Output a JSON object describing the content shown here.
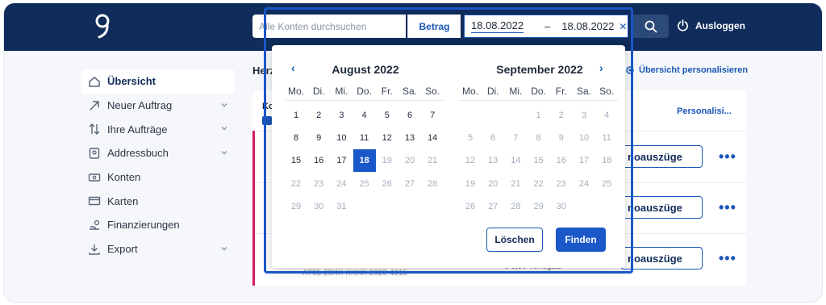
{
  "colors": {
    "navy": "#0f2c5a",
    "accent": "#1a57c8",
    "stripe": "#d81b60"
  },
  "header": {
    "logout_label": "Ausloggen"
  },
  "search": {
    "placeholder": "Alle Konten durchsuchen",
    "amount_label": "Betrag",
    "date_from": "18.08.2022",
    "date_separator": "–",
    "date_to": "18.08.2022",
    "clear_icon": "close-icon"
  },
  "sidebar": {
    "items": [
      {
        "label": "Übersicht",
        "icon": "home-icon",
        "expandable": false,
        "active": true
      },
      {
        "label": "Neuer Auftrag",
        "icon": "arrow-up-right-icon",
        "expandable": true
      },
      {
        "label": "Ihre Aufträge",
        "icon": "transfer-icon",
        "expandable": true
      },
      {
        "label": "Addressbuch",
        "icon": "address-book-icon",
        "expandable": true
      },
      {
        "label": "Konten",
        "icon": "bank-note-icon",
        "expandable": false
      },
      {
        "label": "Karten",
        "icon": "card-icon",
        "expandable": false
      },
      {
        "label": "Finanzierungen",
        "icon": "financing-icon",
        "expandable": false
      },
      {
        "label": "Export",
        "icon": "download-icon",
        "expandable": true
      }
    ]
  },
  "main": {
    "heading_partial": "Herz",
    "personalize_top": "Übersicht personalisieren",
    "section_title_partial": "Ko",
    "personalize_right": "Personalisi...",
    "row_button_label": "noauszüge",
    "more_label": "•••",
    "iban_partial": "AT05 20XX XXXX 2020 4015",
    "available_partial": "€ 0,00 verfügbar"
  },
  "datepicker": {
    "months": [
      {
        "title": "August 2022",
        "weekdays": [
          "Mo.",
          "Di.",
          "Mi.",
          "Do.",
          "Fr.",
          "Sa.",
          "So."
        ],
        "weeks": [
          [
            "1",
            "2",
            "3",
            "4",
            "5",
            "6",
            "7"
          ],
          [
            "8",
            "9",
            "10",
            "11",
            "12",
            "13",
            "14"
          ],
          [
            "15",
            "16",
            "17",
            "18",
            "19",
            "20",
            "21"
          ],
          [
            "22",
            "23",
            "24",
            "25",
            "26",
            "27",
            "28"
          ],
          [
            "29",
            "30",
            "31",
            "",
            "",
            "",
            ""
          ]
        ],
        "enabled_through": 18,
        "selected": 18
      },
      {
        "title": "September 2022",
        "weekdays": [
          "Mo.",
          "Di.",
          "Mi.",
          "Do.",
          "Fr.",
          "Sa.",
          "So."
        ],
        "weeks": [
          [
            "",
            "",
            "",
            "1",
            "2",
            "3",
            "4"
          ],
          [
            "5",
            "6",
            "7",
            "8",
            "9",
            "10",
            "11"
          ],
          [
            "12",
            "13",
            "14",
            "15",
            "16",
            "17",
            "18"
          ],
          [
            "19",
            "20",
            "21",
            "22",
            "23",
            "24",
            "25"
          ],
          [
            "26",
            "27",
            "28",
            "29",
            "30",
            "",
            ""
          ]
        ],
        "enabled_through": 0,
        "selected": null
      }
    ],
    "clear_label": "Löschen",
    "find_label": "Finden"
  }
}
